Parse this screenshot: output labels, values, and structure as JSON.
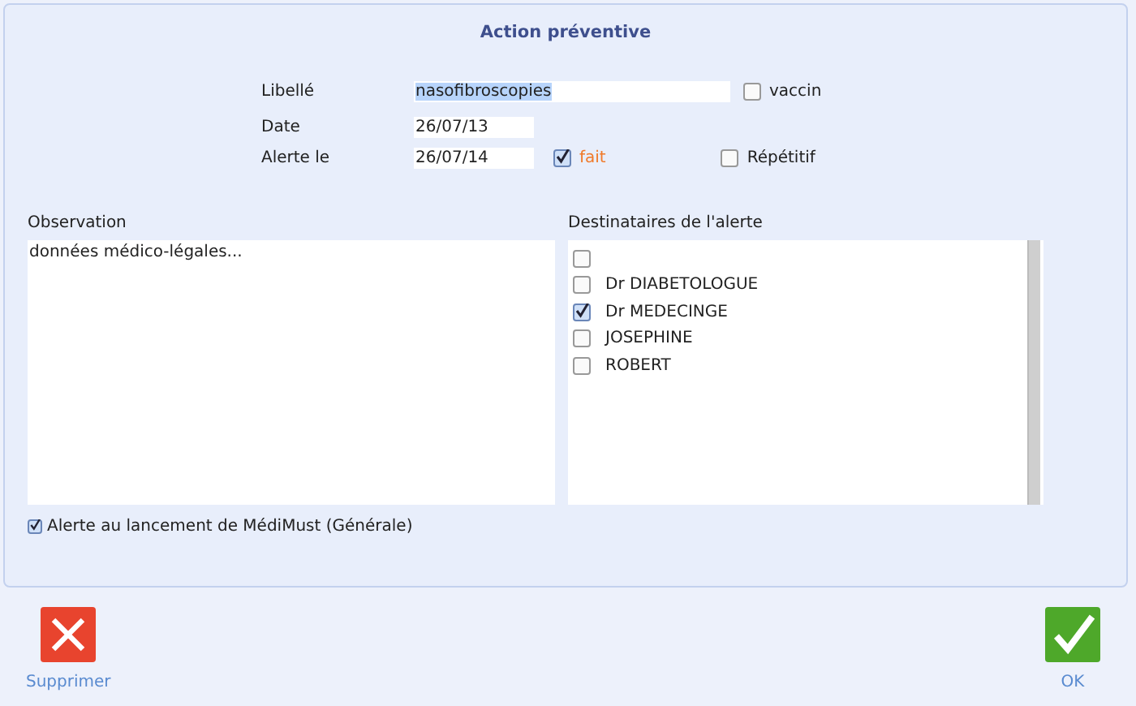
{
  "title": "Action préventive",
  "form": {
    "libelle": {
      "label": "Libellé",
      "value": "nasofibroscopies",
      "selected_text": true
    },
    "vaccin": {
      "label": "vaccin",
      "checked": false
    },
    "date": {
      "label": "Date",
      "value": "26/07/13"
    },
    "alerte": {
      "label": "Alerte le",
      "value": "26/07/14"
    },
    "fait": {
      "label": "fait",
      "checked": true
    },
    "repetitif": {
      "label": "Répétitif",
      "checked": false
    }
  },
  "observation": {
    "label": "Observation",
    "value": "données médico-légales..."
  },
  "recipients": {
    "label": "Destinataires de l'alerte",
    "items": [
      {
        "checked": false
      },
      {
        "name": "Dr DIABETOLOGUE",
        "checked": false
      },
      {
        "name": "Dr MEDECINGE",
        "checked": true
      },
      {
        "name": "JOSEPHINE",
        "checked": false
      },
      {
        "name": "ROBERT",
        "checked": false
      }
    ]
  },
  "launch_alert": {
    "label": "Alerte au lancement de MédiMust (Générale)",
    "checked": true
  },
  "buttons": [
    {
      "kind": "delete",
      "label": "Supprimer"
    },
    {
      "kind": "ok",
      "label": "OK"
    }
  ]
}
